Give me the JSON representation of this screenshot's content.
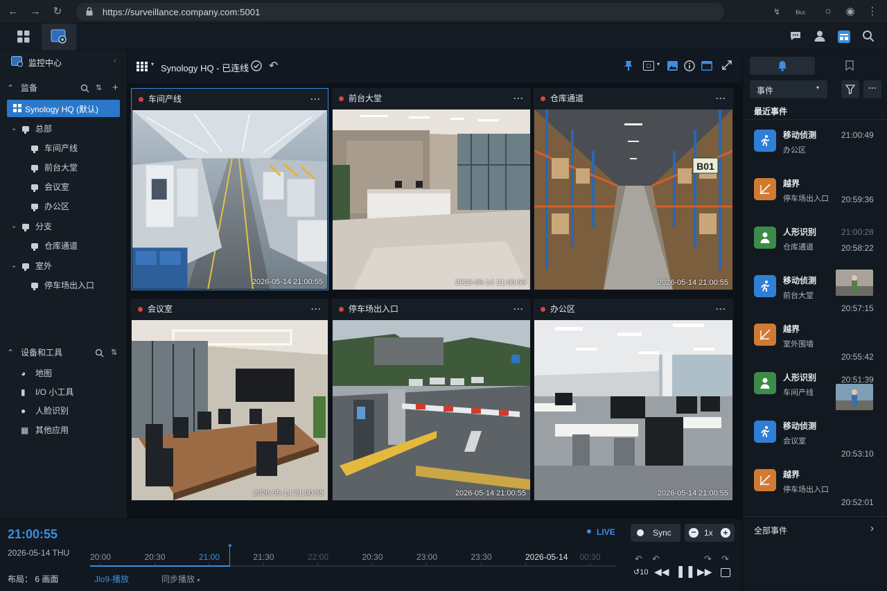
{
  "browser": {
    "url": "https://surveillance.company.com:5001"
  },
  "sidebar": {
    "app_title": "监控中心",
    "section_cameras": "监备",
    "selected_layout": "Synology HQ (默认)",
    "groups": [
      {
        "label": "总部",
        "cameras": [
          "车间产线",
          "前台大堂",
          "会议室",
          "办公区"
        ]
      },
      {
        "label": "分支",
        "cameras": [
          "仓库通道"
        ]
      },
      {
        "label": "室外",
        "cameras": [
          "停车场出入口"
        ]
      }
    ],
    "section_tools": "设备和工具",
    "tools": [
      "地图",
      "I/O 小工具",
      "人脸识别",
      "其他应用"
    ]
  },
  "toolbar": {
    "title": "Synology HQ - 已连线"
  },
  "tiles": [
    {
      "name": "车间产线",
      "timestamp": "2026-05-14  21:00:55"
    },
    {
      "name": "前台大堂",
      "timestamp": "2026-05-14  21:00:55"
    },
    {
      "name": "仓库通道",
      "timestamp": "2026-05-14  21:00:55"
    },
    {
      "name": "会议室",
      "timestamp": "2026-05-14  21:00:55"
    },
    {
      "name": "停车场出入口",
      "timestamp": "2026-05-14  21:00:55"
    },
    {
      "name": "办公区",
      "timestamp": "2026-05-14  21:00:55"
    }
  ],
  "warehouse_sign": "B01",
  "right_panel": {
    "filter_label": "事件",
    "recent_title": "最近事件",
    "all_events": "全部事件",
    "events": [
      {
        "type": "移动侦测",
        "location": "办公区",
        "time": "21:00:49",
        "color": "#2f7fd6",
        "icon": "running-person-icon"
      },
      {
        "type": "越界",
        "location": "停车场出入口",
        "time": "20:59:36",
        "color": "#d07a32",
        "icon": "line-cross-icon"
      },
      {
        "type": "人形识别",
        "location": "仓库通道",
        "time": "20:58:22",
        "time_ghost": "21:00:28",
        "color": "#3d8b48",
        "icon": "person-icon"
      },
      {
        "type": "移动侦测",
        "location": "前台大堂",
        "time": "20:57:15",
        "color": "#2f7fd6",
        "icon": "running-person-icon"
      },
      {
        "type": "越界",
        "location": "室外围墙",
        "time": "20:55:42",
        "color": "#d07a32",
        "icon": "line-cross-icon"
      },
      {
        "type": "人形识别",
        "location": "车间产线",
        "time": "20:51:39",
        "color": "#3d8b48",
        "icon": "person-icon"
      },
      {
        "type": "移动侦测",
        "location": "会议室",
        "time": "20:53:10",
        "color": "#2f7fd6",
        "icon": "running-person-icon"
      },
      {
        "type": "越界",
        "location": "停车场出入口",
        "time": "20:52:01",
        "color": "#d07a32",
        "icon": "line-cross-icon"
      }
    ]
  },
  "bottom": {
    "clock": "21:00:55",
    "date": "2026-05-14 THU",
    "live": "LIVE",
    "sync": "Sync",
    "speed": "1x",
    "layout_label": "布局：  6 画面",
    "playback_label": "Jlo9-播放",
    "sync_playback": "同步播放",
    "ticks": [
      "20:00",
      "20:30",
      "21:00",
      "21:30",
      "22:00",
      "20:30",
      "23:00",
      "23:30",
      "2026-05-14",
      "00:30"
    ],
    "playback_position": 0.265
  }
}
